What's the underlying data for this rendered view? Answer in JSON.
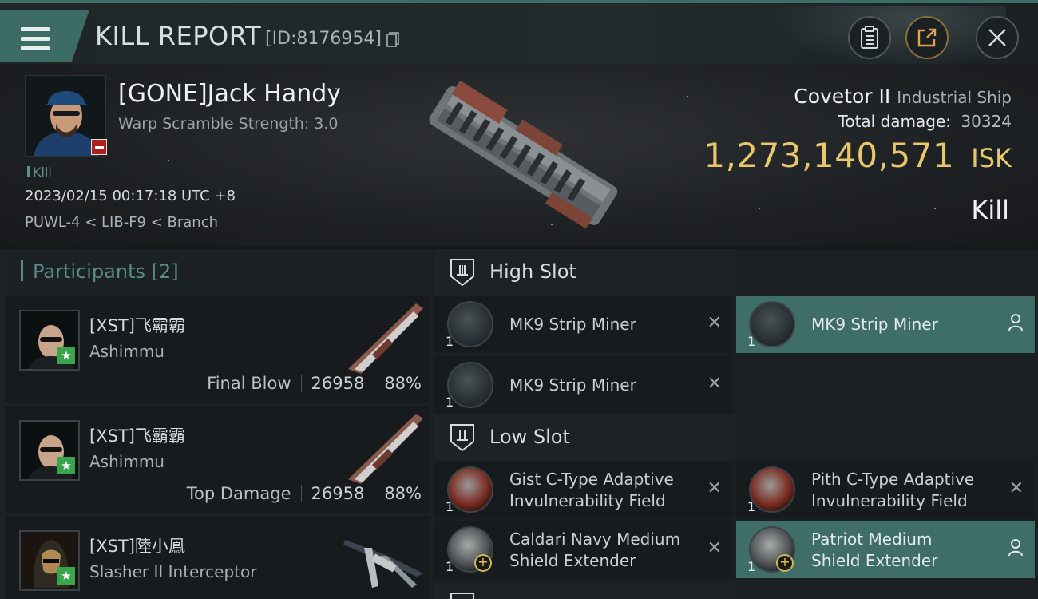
{
  "header": {
    "title": "KILL REPORT",
    "id_label": "[ID:8176954]"
  },
  "victim": {
    "name": "[GONE]Jack Handy",
    "warp_scramble": "Warp Scramble Strength: 3.0",
    "kill_tag": "Kill",
    "datetime": "2023/02/15 00:17:18 UTC +8",
    "location": "PUWL-4 < LIB-F9 < Branch",
    "ship_name": "Covetor II",
    "ship_class": "Industrial Ship",
    "total_damage_label": "Total damage:",
    "total_damage": "30324",
    "isk_value": "1,273,140,571",
    "isk_unit": "ISK",
    "result": "Kill"
  },
  "participants": {
    "title": "Participants [2]",
    "rows": [
      {
        "name": "[XST]飞霸霸",
        "ship": "Ashimmu",
        "role": "Final Blow",
        "damage": "26958",
        "percent": "88%"
      },
      {
        "name": "[XST]飞霸霸",
        "ship": "Ashimmu",
        "role": "Top Damage",
        "damage": "26958",
        "percent": "88%"
      },
      {
        "name": "[XST]陸小鳳",
        "ship": "Slasher II Interceptor",
        "role": "",
        "damage": "",
        "percent": ""
      }
    ]
  },
  "slots": {
    "high": {
      "title": "High Slot",
      "modules": [
        {
          "name_line1": "MK9 Strip Miner",
          "name_line2": "",
          "qty": "1",
          "state": "destroyed"
        },
        {
          "name_line1": "MK9 Strip Miner",
          "name_line2": "",
          "qty": "1",
          "state": "dropped"
        },
        {
          "name_line1": "MK9 Strip Miner",
          "name_line2": "",
          "qty": "1",
          "state": "destroyed"
        }
      ]
    },
    "low": {
      "title": "Low Slot",
      "modules": [
        {
          "name_line1": "Gist C-Type Adaptive",
          "name_line2": "Invulnerability Field",
          "qty": "1",
          "state": "destroyed"
        },
        {
          "name_line1": "Pith C-Type Adaptive",
          "name_line2": "Invulnerability Field",
          "qty": "1",
          "state": "destroyed"
        },
        {
          "name_line1": "Caldari Navy Medium",
          "name_line2": "Shield Extender",
          "qty": "1",
          "state": "destroyed"
        },
        {
          "name_line1": "Patriot Medium",
          "name_line2": "Shield Extender",
          "qty": "1",
          "state": "dropped"
        }
      ]
    }
  },
  "icons": {
    "destroyed": "close-icon",
    "dropped": "person-icon"
  },
  "colors": {
    "accent": "#3d6c67",
    "isk": "#e7c76a",
    "corp_badge": "#39a54a",
    "loss_badge": "#b0201c"
  }
}
